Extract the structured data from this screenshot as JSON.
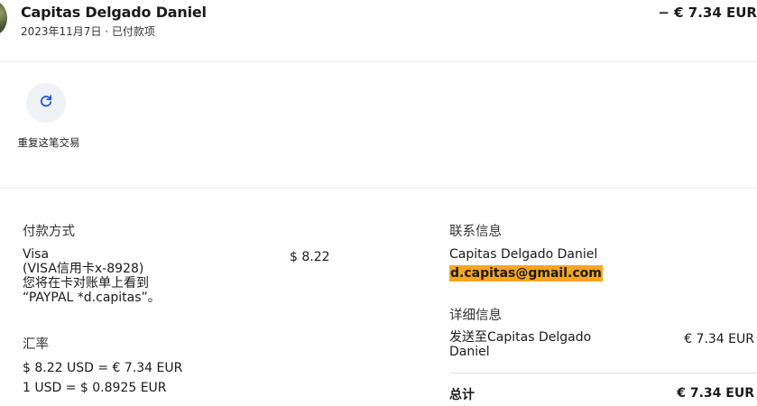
{
  "header": {
    "name": "Capitas Delgado Daniel",
    "subtitle": "2023年11月7日 · 已付款项",
    "amount": "− € 7.34 EUR"
  },
  "actions": {
    "repeat_label": "重复这笔交易",
    "repeat_icon": "refresh-icon"
  },
  "payment": {
    "title": "付款方式",
    "method": "Visa",
    "card_line": "(VISA信用卡x-8928)",
    "statement_line1": "您将在卡对账单上看到",
    "statement_line2": "“PAYPAL *d.capitas”。",
    "amount": "$ 8.22"
  },
  "exchange": {
    "title": "汇率",
    "line1": "$ 8.22 USD = € 7.34 EUR",
    "line2": "1 USD = $ 0.8925 EUR"
  },
  "contact": {
    "title": "联系信息",
    "name": "Capitas Delgado Daniel",
    "email": "d.capitas@gmail.com"
  },
  "details": {
    "title": "详细信息",
    "sent_to": "发送至Capitas Delgado Daniel",
    "sent_amount": "€ 7.34 EUR",
    "total_label": "总计",
    "total_amount": "€ 7.34 EUR"
  },
  "colors": {
    "email_highlight": "#f5a623",
    "repeat_button_bg": "#eef1f6",
    "icon_blue": "#1e4fd6"
  }
}
